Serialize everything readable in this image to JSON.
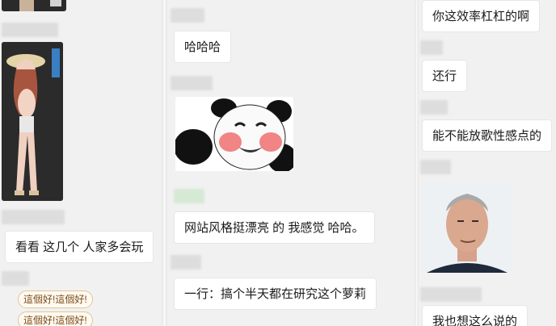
{
  "columns": {
    "left": {
      "messages": [
        {
          "text": "看看 这几个 人家多会玩"
        }
      ],
      "sticker_lines": [
        "這個好!這個好!",
        "這個好!這個好!"
      ],
      "images": [
        {
          "icon": "anime-character-image"
        }
      ]
    },
    "middle": {
      "messages": [
        {
          "text": "哈哈哈"
        },
        {
          "text": "网站风格挺漂亮 的 我感觉 哈哈。"
        },
        {
          "text": "一行：搞个半天都在研究这个萝莉"
        }
      ],
      "images": [
        {
          "icon": "panda-meme-sticker"
        }
      ]
    },
    "right": {
      "messages": [
        {
          "text": "你这效率杠杠的啊"
        },
        {
          "text": "还行"
        },
        {
          "text": "能不能放歌性感点的"
        },
        {
          "text": "我也想这么说的"
        }
      ],
      "images": [
        {
          "icon": "man-face-photo"
        }
      ]
    }
  },
  "colors": {
    "background": "#f1f1f1",
    "bubble": "#ffffff",
    "border": "#e6e6e6"
  }
}
